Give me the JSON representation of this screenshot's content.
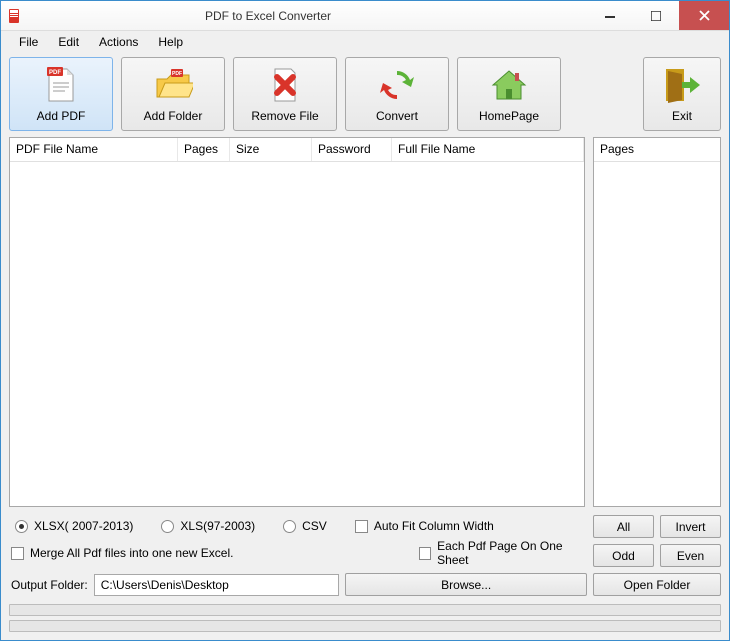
{
  "window": {
    "title": "PDF to Excel Converter"
  },
  "menu": {
    "file": "File",
    "edit": "Edit",
    "actions": "Actions",
    "help": "Help"
  },
  "toolbar": {
    "add_pdf": "Add PDF",
    "add_folder": "Add Folder",
    "remove_file": "Remove File",
    "convert": "Convert",
    "homepage": "HomePage",
    "exit": "Exit"
  },
  "columns": {
    "pdf_file_name": "PDF File Name",
    "pages": "Pages",
    "size": "Size",
    "password": "Password",
    "full_file_name": "Full File Name",
    "pages_panel": "Pages"
  },
  "options": {
    "xlsx": "XLSX( 2007-2013)",
    "xls": "XLS(97-2003)",
    "csv": "CSV",
    "autofit": "Auto Fit Column Width",
    "merge": "Merge All Pdf files into one new Excel.",
    "each_page": "Each Pdf Page On One Sheet"
  },
  "buttons": {
    "all": "All",
    "invert": "Invert",
    "odd": "Odd",
    "even": "Even",
    "browse": "Browse...",
    "open_folder": "Open Folder"
  },
  "output": {
    "label": "Output Folder:",
    "value": "C:\\Users\\Denis\\Desktop"
  }
}
